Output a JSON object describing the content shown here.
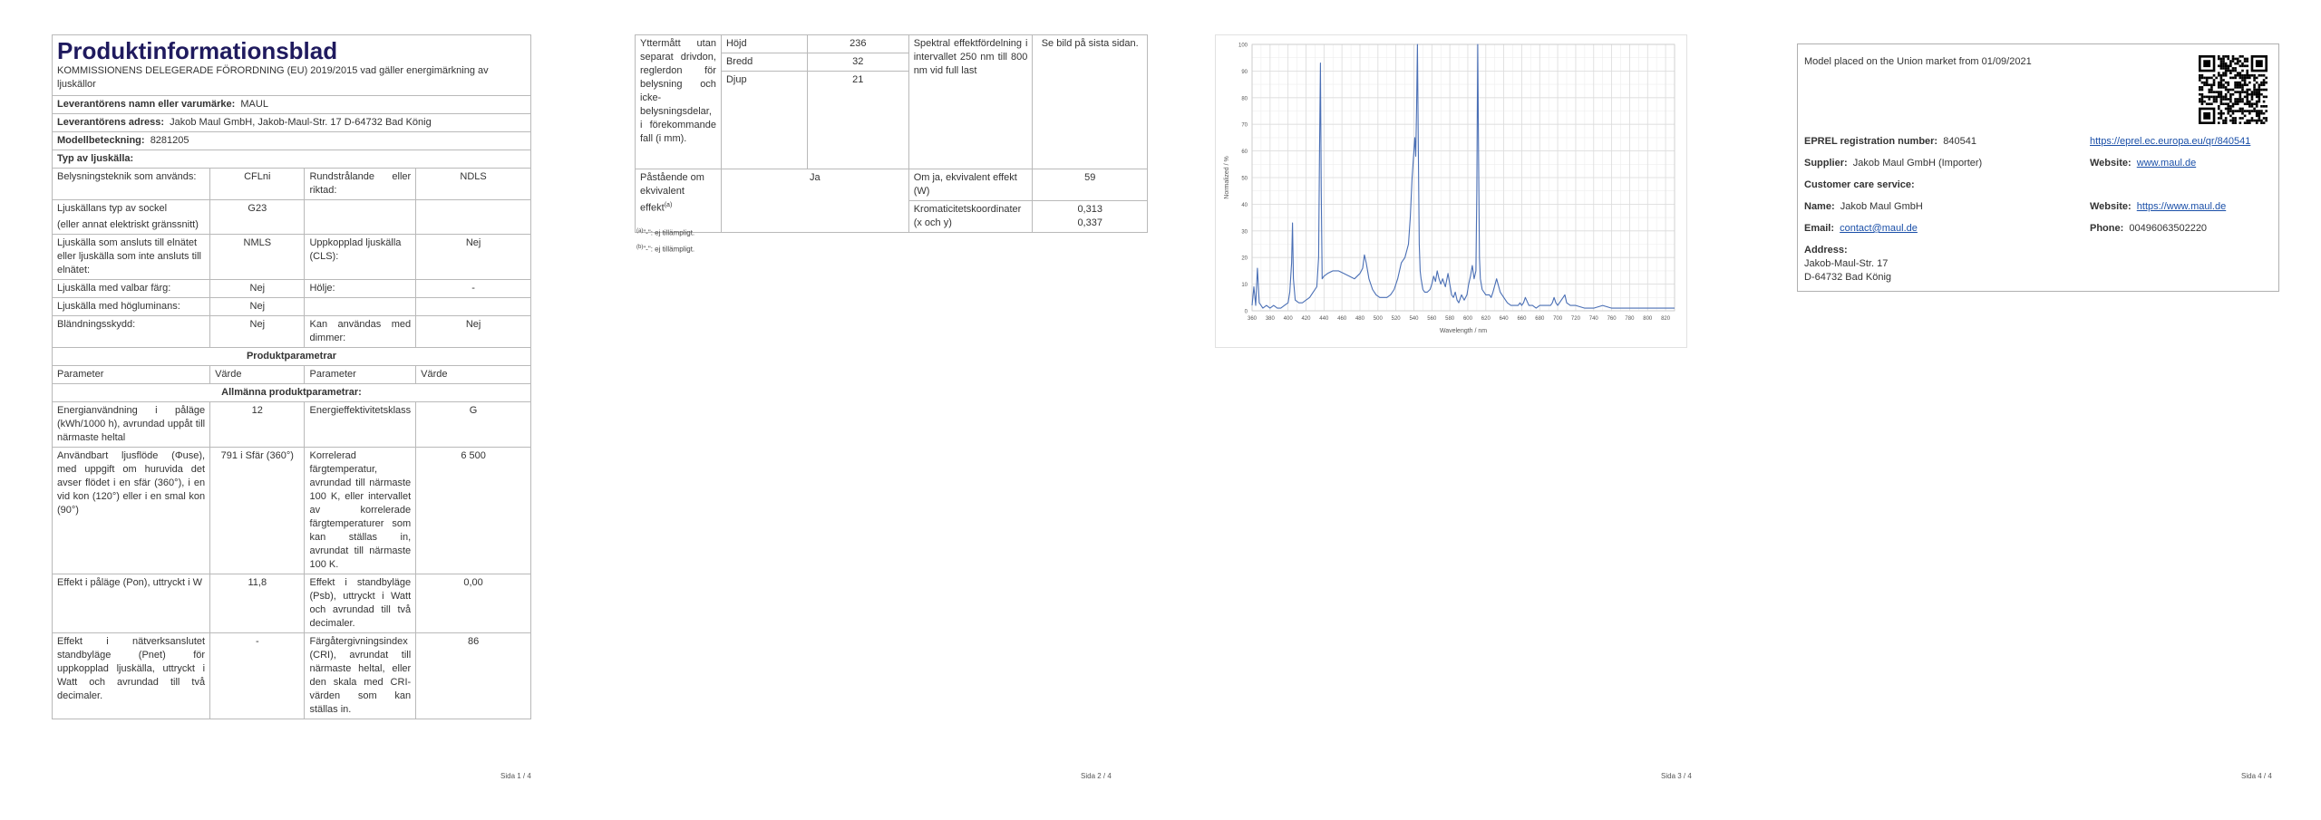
{
  "p1": {
    "title": "Produktinformationsblad",
    "regulation": "KOMMISSIONENS DELEGERADE FÖRORDNING (EU) 2019/2015 vad gäller energimärkning av ljuskällor",
    "supplier_name_label": "Leverantörens namn eller varumärke:",
    "supplier_name": "MAUL",
    "supplier_addr_label": "Leverantörens adress:",
    "supplier_addr": "Jakob Maul GmbH, Jakob-Maul-Str. 17 D-64732 Bad König",
    "model_label": "Modellbeteckning:",
    "model": "8281205",
    "type_heading": "Typ av ljuskälla:",
    "r_tech_label": "Belysningsteknik som används:",
    "r_tech_val": "CFLni",
    "r_dir_label": "Rundstrålande eller riktad:",
    "r_dir_val": "NDLS",
    "r_cap_label1": "Ljuskällans typ av sockel",
    "r_cap_label2": "(eller annat elektriskt gränssnitt)",
    "r_cap_val": "G23",
    "r_mains_label": "Ljuskälla som ansluts till elnätet eller ljuskälla som inte ansluts till elnätet:",
    "r_mains_val": "NMLS",
    "r_cls_label": "Uppkopplad ljuskälla (CLS):",
    "r_cls_val": "Nej",
    "r_colour_label": "Ljuskälla med valbar färg:",
    "r_colour_val": "Nej",
    "r_env_label": "Hölje:",
    "r_env_val": "-",
    "r_hl_label": "Ljuskälla med högluminans:",
    "r_hl_val": "Nej",
    "r_glare_label": "Bländningsskydd:",
    "r_glare_val": "Nej",
    "r_dim_label": "Kan användas med dimmer:",
    "r_dim_val": "Nej",
    "product_params": "Produktparametrar",
    "col_param": "Parameter",
    "col_value": "Värde",
    "general_params": "Allmänna produktparametrar:",
    "r_energy_label": "Energianvändning i påläge (kWh/1000 h), avrundad uppåt till närmaste heltal",
    "r_energy_val": "12",
    "r_eclass_label": "Energieffektivitetsklass",
    "r_eclass_val": "G",
    "r_flux_label": "Användbart ljusflöde (Φuse), med uppgift om huruvida det avser flödet i en sfär (360°), i en vid kon (120°) eller i en smal kon (90°)",
    "r_flux_val": "791 i Sfär (360°)",
    "r_cct_label": "Korrelerad färgtemperatur, avrundad till närmaste 100 K, eller intervallet av korrelerade färgtemperaturer som kan ställas in, avrundat till närmaste 100 K.",
    "r_cct_val": "6 500",
    "r_pon_label": "Effekt i påläge (Pon), uttryckt i W",
    "r_pon_val": "11,8",
    "r_psb_label": "Effekt i standbyläge (Psb), uttryckt i Watt och avrundad till två decimaler.",
    "r_psb_val": "0,00",
    "r_pnet_label": "Effekt i nätverksanslutet standbyläge (Pnet) för uppkopplad ljuskälla, uttryckt i Watt och avrundad till två decimaler.",
    "r_pnet_val": "-",
    "r_cri_label": "Färgåtergivningsindex (CRI), avrundat till närmaste heltal, eller den skala med CRI-värden som kan ställas in.",
    "r_cri_val": "86",
    "page_num": "Sida 1 / 4"
  },
  "p2": {
    "outer_dim_label": "Yttermått utan separat drivdon, reglerdon för belysning och icke-belysningsdelar, i förekommande fall (i mm).",
    "height_label": "Höjd",
    "height_val": "236",
    "width_label": "Bredd",
    "width_val": "32",
    "depth_label": "Djup",
    "depth_val": "21",
    "spectral_label": "Spektral effektfördelning i intervallet 250 nm till 800 nm vid full last",
    "spectral_val": "Se bild på sista sidan.",
    "equiv_claim_label": "Påstående om ekvivalent effekt",
    "equiv_claim_sup": "(a)",
    "equiv_claim_val": "Ja",
    "equiv_power_label": "Om ja, ekvivalent effekt (W)",
    "equiv_power_val": "59",
    "chroma_label": "Kromaticitetskoordinater (x och y)",
    "chroma_x": "0,313",
    "chroma_y": "0,337",
    "footnote_a_mark": "(a)",
    "footnote_a": "\"-\": ej tillämpligt.",
    "footnote_b_mark": "(b)",
    "footnote_b": "\"-\": ej tillämpligt.",
    "page_num": "Sida 2 / 4"
  },
  "p3": {
    "page_num": "Sida 3 / 4",
    "chart_data": {
      "type": "line",
      "title": "",
      "xlabel": "Wavelength / nm",
      "ylabel": "Normalized / %",
      "xlim": [
        360,
        830
      ],
      "ylim": [
        0,
        100
      ],
      "xticks": [
        360,
        380,
        400,
        420,
        440,
        460,
        480,
        500,
        520,
        540,
        560,
        580,
        600,
        620,
        640,
        660,
        680,
        700,
        720,
        740,
        760,
        780,
        800,
        820
      ],
      "yticks": [
        0,
        10,
        20,
        30,
        40,
        50,
        60,
        70,
        80,
        90,
        100
      ],
      "grid": true,
      "color": "#4a6fb5",
      "series": [
        {
          "x": [
            360,
            362,
            364,
            366,
            368,
            370,
            372,
            376,
            380,
            384,
            388,
            392,
            396,
            400,
            402,
            404,
            405,
            406,
            408,
            412,
            416,
            420,
            424,
            428,
            432,
            434,
            435,
            436,
            437,
            438,
            440,
            444,
            450,
            456,
            462,
            468,
            474,
            480,
            483,
            485,
            487,
            490,
            494,
            498,
            502,
            506,
            510,
            514,
            518,
            522,
            526,
            530,
            534,
            536,
            538,
            541,
            542,
            543,
            544,
            545,
            546,
            547,
            548,
            550,
            552,
            555,
            558,
            560,
            562,
            564,
            566,
            568,
            570,
            572,
            575,
            578,
            580,
            582,
            584,
            586,
            588,
            590,
            593,
            596,
            599,
            601,
            603,
            605,
            607,
            609,
            610,
            611,
            612,
            613,
            614,
            616,
            620,
            624,
            626,
            628,
            632,
            636,
            640,
            644,
            648,
            652,
            656,
            658,
            660,
            662,
            664,
            668,
            672,
            676,
            680,
            684,
            688,
            692,
            694,
            696,
            698,
            700,
            704,
            706,
            708,
            710,
            714,
            720,
            730,
            740,
            750,
            760,
            770,
            780,
            790,
            800,
            810,
            820,
            830
          ],
          "y": [
            2,
            9,
            2,
            16,
            3,
            2,
            1,
            2,
            1,
            2,
            1,
            1,
            2,
            3,
            7,
            18,
            33,
            12,
            4,
            3,
            3,
            4,
            5,
            7,
            9,
            20,
            60,
            93,
            45,
            12,
            13,
            14,
            15,
            15,
            14,
            13,
            12,
            14,
            16,
            21,
            18,
            12,
            8,
            6,
            5,
            5,
            5,
            6,
            8,
            12,
            18,
            20,
            25,
            35,
            50,
            65,
            58,
            75,
            100,
            60,
            25,
            15,
            12,
            8,
            7,
            7,
            8,
            10,
            13,
            11,
            15,
            12,
            10,
            12,
            9,
            14,
            10,
            6,
            5,
            7,
            4,
            3,
            6,
            4,
            6,
            10,
            13,
            17,
            12,
            15,
            45,
            100,
            55,
            20,
            12,
            8,
            6,
            6,
            5,
            7,
            12,
            7,
            5,
            3,
            2,
            2,
            2,
            3,
            2,
            3,
            5,
            2,
            2,
            1,
            2,
            2,
            2,
            2,
            3,
            5,
            3,
            2,
            4,
            5,
            6,
            3,
            2,
            2,
            1,
            1,
            2,
            1,
            1,
            1,
            1,
            1,
            1,
            1,
            1
          ]
        }
      ]
    }
  },
  "p4": {
    "placed": "Model placed on the Union market from 01/09/2021",
    "eprel_label": "EPREL registration number:",
    "eprel_val": "840541",
    "eprel_link": "https://eprel.ec.europa.eu/qr/840541",
    "supplier_label": "Supplier:",
    "supplier_val": "Jakob Maul GmbH (Importer)",
    "website_label": "Website:",
    "website_val": "www.maul.de",
    "care_label": "Customer care service:",
    "name_label": "Name:",
    "name_val": "Jakob Maul GmbH",
    "website2_label": "Website:",
    "website2_val": "https://www.maul.de",
    "email_label": "Email:",
    "email_val": "contact@maul.de",
    "phone_label": "Phone:",
    "phone_val": "00496063502220",
    "address_label": "Address:",
    "address_line1": "Jakob-Maul-Str. 17",
    "address_line2": "D-64732 Bad König",
    "page_num": "Sida 4 / 4"
  }
}
